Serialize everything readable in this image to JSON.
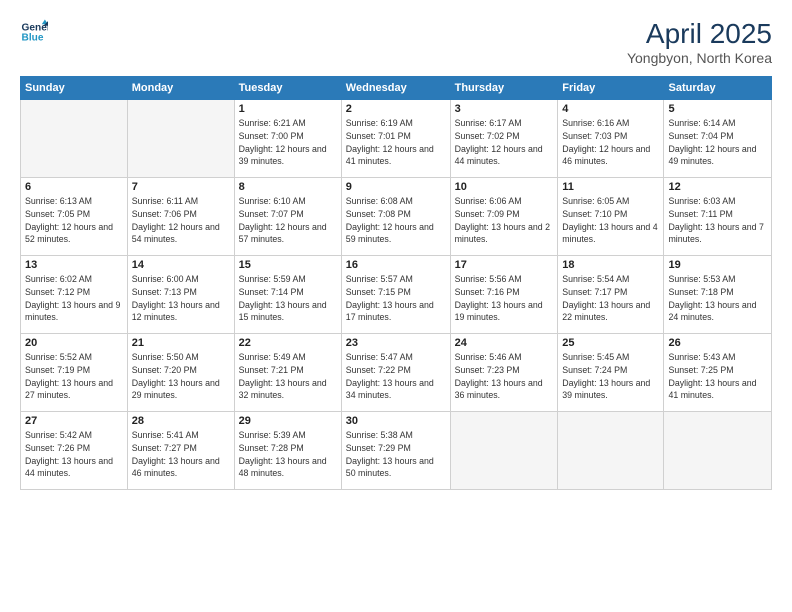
{
  "header": {
    "logo_line1": "General",
    "logo_line2": "Blue",
    "main_title": "April 2025",
    "subtitle": "Yongbyon, North Korea"
  },
  "days_of_week": [
    "Sunday",
    "Monday",
    "Tuesday",
    "Wednesday",
    "Thursday",
    "Friday",
    "Saturday"
  ],
  "weeks": [
    [
      {
        "day": "",
        "info": ""
      },
      {
        "day": "",
        "info": ""
      },
      {
        "day": "1",
        "info": "Sunrise: 6:21 AM\nSunset: 7:00 PM\nDaylight: 12 hours and 39 minutes."
      },
      {
        "day": "2",
        "info": "Sunrise: 6:19 AM\nSunset: 7:01 PM\nDaylight: 12 hours and 41 minutes."
      },
      {
        "day": "3",
        "info": "Sunrise: 6:17 AM\nSunset: 7:02 PM\nDaylight: 12 hours and 44 minutes."
      },
      {
        "day": "4",
        "info": "Sunrise: 6:16 AM\nSunset: 7:03 PM\nDaylight: 12 hours and 46 minutes."
      },
      {
        "day": "5",
        "info": "Sunrise: 6:14 AM\nSunset: 7:04 PM\nDaylight: 12 hours and 49 minutes."
      }
    ],
    [
      {
        "day": "6",
        "info": "Sunrise: 6:13 AM\nSunset: 7:05 PM\nDaylight: 12 hours and 52 minutes."
      },
      {
        "day": "7",
        "info": "Sunrise: 6:11 AM\nSunset: 7:06 PM\nDaylight: 12 hours and 54 minutes."
      },
      {
        "day": "8",
        "info": "Sunrise: 6:10 AM\nSunset: 7:07 PM\nDaylight: 12 hours and 57 minutes."
      },
      {
        "day": "9",
        "info": "Sunrise: 6:08 AM\nSunset: 7:08 PM\nDaylight: 12 hours and 59 minutes."
      },
      {
        "day": "10",
        "info": "Sunrise: 6:06 AM\nSunset: 7:09 PM\nDaylight: 13 hours and 2 minutes."
      },
      {
        "day": "11",
        "info": "Sunrise: 6:05 AM\nSunset: 7:10 PM\nDaylight: 13 hours and 4 minutes."
      },
      {
        "day": "12",
        "info": "Sunrise: 6:03 AM\nSunset: 7:11 PM\nDaylight: 13 hours and 7 minutes."
      }
    ],
    [
      {
        "day": "13",
        "info": "Sunrise: 6:02 AM\nSunset: 7:12 PM\nDaylight: 13 hours and 9 minutes."
      },
      {
        "day": "14",
        "info": "Sunrise: 6:00 AM\nSunset: 7:13 PM\nDaylight: 13 hours and 12 minutes."
      },
      {
        "day": "15",
        "info": "Sunrise: 5:59 AM\nSunset: 7:14 PM\nDaylight: 13 hours and 15 minutes."
      },
      {
        "day": "16",
        "info": "Sunrise: 5:57 AM\nSunset: 7:15 PM\nDaylight: 13 hours and 17 minutes."
      },
      {
        "day": "17",
        "info": "Sunrise: 5:56 AM\nSunset: 7:16 PM\nDaylight: 13 hours and 19 minutes."
      },
      {
        "day": "18",
        "info": "Sunrise: 5:54 AM\nSunset: 7:17 PM\nDaylight: 13 hours and 22 minutes."
      },
      {
        "day": "19",
        "info": "Sunrise: 5:53 AM\nSunset: 7:18 PM\nDaylight: 13 hours and 24 minutes."
      }
    ],
    [
      {
        "day": "20",
        "info": "Sunrise: 5:52 AM\nSunset: 7:19 PM\nDaylight: 13 hours and 27 minutes."
      },
      {
        "day": "21",
        "info": "Sunrise: 5:50 AM\nSunset: 7:20 PM\nDaylight: 13 hours and 29 minutes."
      },
      {
        "day": "22",
        "info": "Sunrise: 5:49 AM\nSunset: 7:21 PM\nDaylight: 13 hours and 32 minutes."
      },
      {
        "day": "23",
        "info": "Sunrise: 5:47 AM\nSunset: 7:22 PM\nDaylight: 13 hours and 34 minutes."
      },
      {
        "day": "24",
        "info": "Sunrise: 5:46 AM\nSunset: 7:23 PM\nDaylight: 13 hours and 36 minutes."
      },
      {
        "day": "25",
        "info": "Sunrise: 5:45 AM\nSunset: 7:24 PM\nDaylight: 13 hours and 39 minutes."
      },
      {
        "day": "26",
        "info": "Sunrise: 5:43 AM\nSunset: 7:25 PM\nDaylight: 13 hours and 41 minutes."
      }
    ],
    [
      {
        "day": "27",
        "info": "Sunrise: 5:42 AM\nSunset: 7:26 PM\nDaylight: 13 hours and 44 minutes."
      },
      {
        "day": "28",
        "info": "Sunrise: 5:41 AM\nSunset: 7:27 PM\nDaylight: 13 hours and 46 minutes."
      },
      {
        "day": "29",
        "info": "Sunrise: 5:39 AM\nSunset: 7:28 PM\nDaylight: 13 hours and 48 minutes."
      },
      {
        "day": "30",
        "info": "Sunrise: 5:38 AM\nSunset: 7:29 PM\nDaylight: 13 hours and 50 minutes."
      },
      {
        "day": "",
        "info": ""
      },
      {
        "day": "",
        "info": ""
      },
      {
        "day": "",
        "info": ""
      }
    ]
  ]
}
